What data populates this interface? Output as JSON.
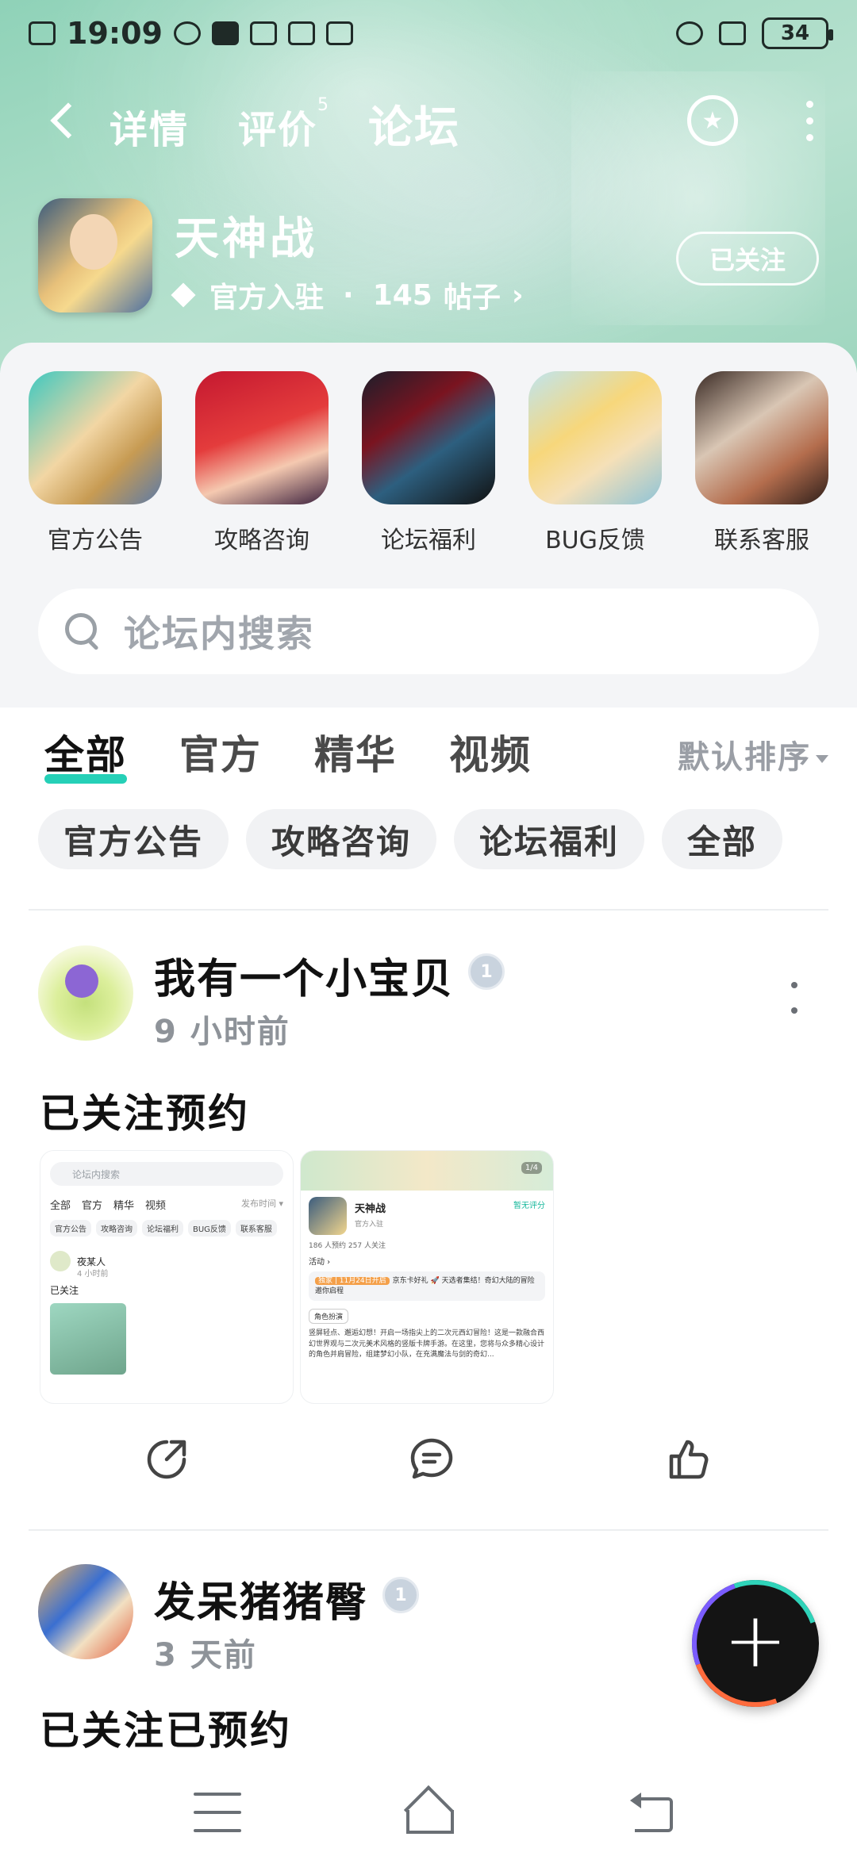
{
  "status_bar": {
    "time": "19:09",
    "battery": "34"
  },
  "header": {
    "tabs": [
      {
        "label": "详情"
      },
      {
        "label": "评价",
        "count": "5"
      },
      {
        "label": "论坛"
      }
    ],
    "active_tab": "论坛"
  },
  "game": {
    "name": "天神战",
    "badge": "官方入驻",
    "separator": "·",
    "posts_count": "145",
    "posts_label": "帖子",
    "chevron": "›",
    "follow_label": "已关注"
  },
  "categories": [
    {
      "label": "官方公告",
      "icon": "official-announcement-icon"
    },
    {
      "label": "攻略咨询",
      "icon": "guide-consult-icon"
    },
    {
      "label": "论坛福利",
      "icon": "forum-welfare-icon"
    },
    {
      "label": "BUG反馈",
      "icon": "bug-feedback-icon"
    },
    {
      "label": "联系客服",
      "icon": "contact-service-icon"
    }
  ],
  "search": {
    "placeholder": "论坛内搜索"
  },
  "feed_tabs": [
    {
      "label": "全部"
    },
    {
      "label": "官方"
    },
    {
      "label": "精华"
    },
    {
      "label": "视频"
    }
  ],
  "sort_label": "默认排序",
  "filter_chips": [
    "官方公告",
    "攻略咨询",
    "论坛福利",
    "全部"
  ],
  "posts": [
    {
      "author": "我有一个小宝贝",
      "time": "9 小时前",
      "content": "已关注预约",
      "level_badge": "1",
      "screenshot1": {
        "search": "论坛内搜索",
        "tabs": [
          "全部",
          "官方",
          "精华",
          "视频"
        ],
        "sort": "发布时间 ▾",
        "chips": [
          "官方公告",
          "攻略咨询",
          "论坛福利",
          "BUG反馈",
          "联系客服"
        ],
        "author": "夜某人",
        "time": "4 小时前",
        "content": "已关注"
      },
      "screenshot2": {
        "page": "1/4",
        "name": "天神战",
        "rating": "暂无评分",
        "official": "官方入驻",
        "stats": "186 人预约   257 人关注",
        "activity": "活动 ›",
        "event_tag": "独家 | 11月24日开启",
        "event_text": "京东卡好礼 🚀 天选者集结！奇幻大陆的冒险邀你启程",
        "tag": "角色扮演",
        "desc": "竖屏轻点、邂逅幻想！开启一场指尖上的二次元西幻冒险！这是一款融合西幻世界观与二次元美术风格的竖版卡牌手游。在这里，您将与众多精心设计的角色并肩冒险，组建梦幻小队，在充满魔法与剑的奇幻..."
      }
    },
    {
      "author": "发呆猪猪臀",
      "time": "3 天前",
      "content": "已关注已预约",
      "level_badge": "1"
    }
  ],
  "fab_label": "+"
}
